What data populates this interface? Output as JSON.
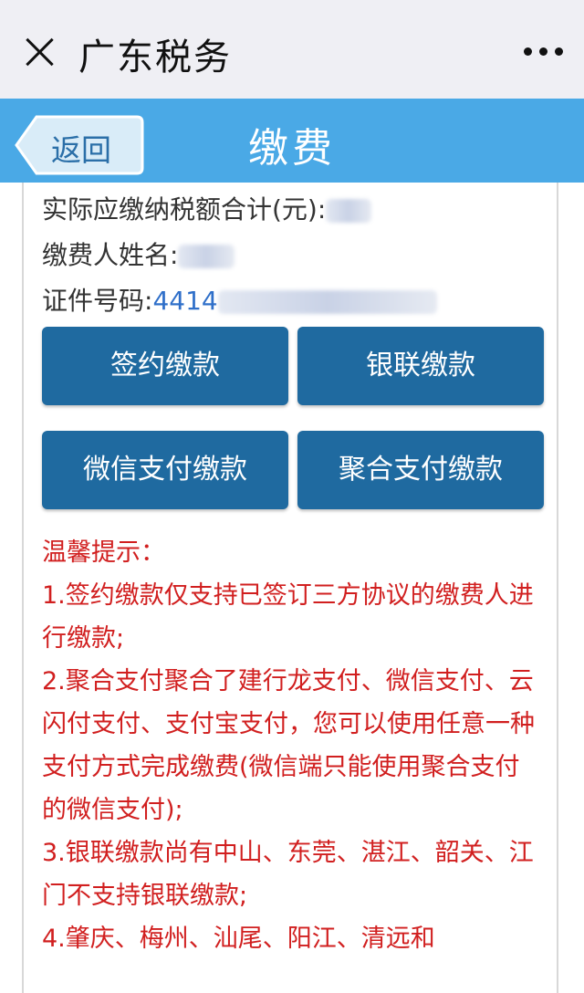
{
  "topbar": {
    "title": "广东税务",
    "close_icon": "close-icon",
    "more_icon": "more-icon"
  },
  "header": {
    "back_label": "返回",
    "title": "缴费"
  },
  "info": {
    "total_label": "实际应缴纳税额合计(元):",
    "payer_label": "缴费人姓名:",
    "id_label": "证件号码:",
    "id_prefix": "4414"
  },
  "buttons": {
    "sign_pay": "签约缴款",
    "unionpay_pay": "银联缴款",
    "wechat_pay": "微信支付缴款",
    "aggregate_pay": "聚合支付缴款"
  },
  "tips": {
    "title": "温馨提示：",
    "line1": "1.签约缴款仅支持已签订三方协议的缴费人进行缴款;",
    "line2": "2.聚合支付聚合了建行龙支付、微信支付、云闪付支付、支付宝支付，您可以使用任意一种支付方式完成缴费(微信端只能使用聚合支付的微信支付);",
    "line3": "3.银联缴款尚有中山、东莞、湛江、韶关、江门不支持银联缴款;",
    "line4": "4.肇庆、梅州、汕尾、阳江、清远和"
  },
  "colors": {
    "header": "#4aa9e6",
    "button": "#1f6aa0",
    "tip_text": "#d11f1f"
  }
}
